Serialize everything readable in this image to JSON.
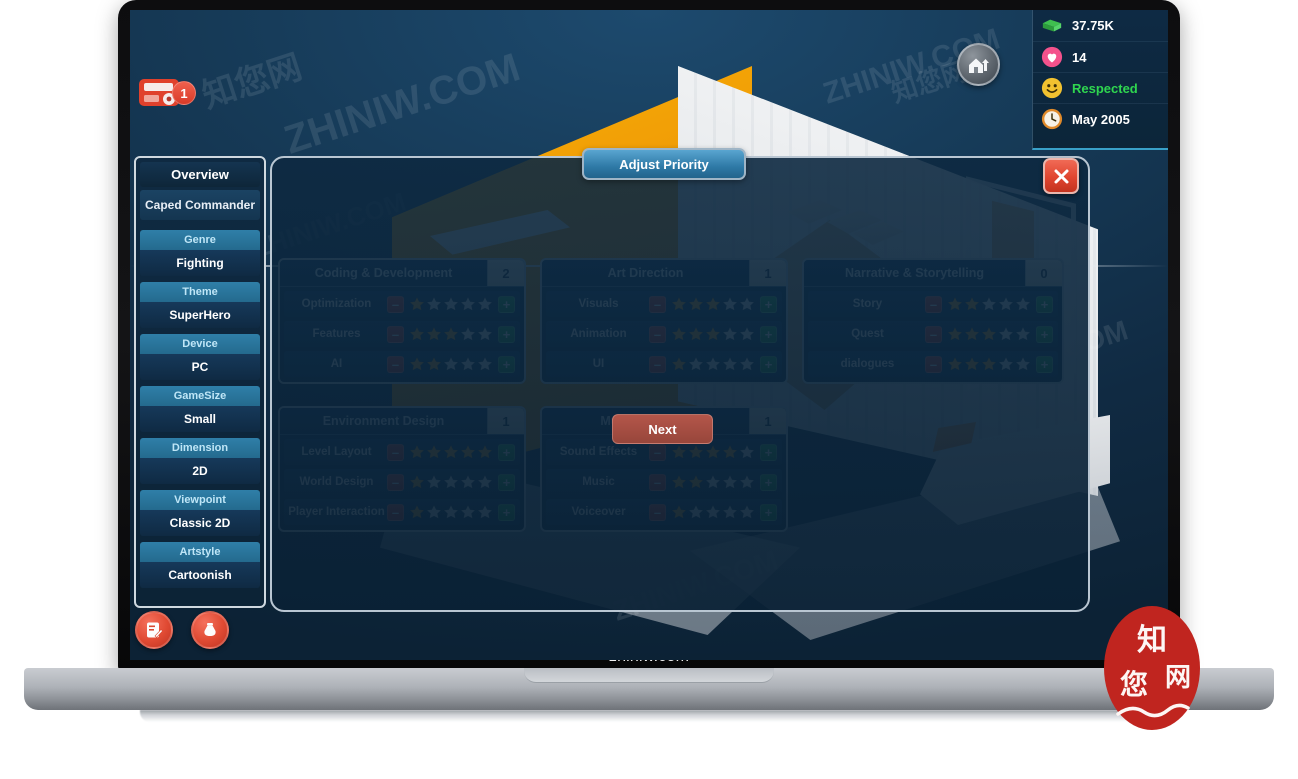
{
  "site_watermark": "zhiniw.com",
  "hud": {
    "money": {
      "icon": "money-icon",
      "value": "37.75K"
    },
    "hearts": {
      "icon": "heart-icon",
      "value": "14"
    },
    "reputation": {
      "icon": "smiley-icon",
      "value": "Respected",
      "color": "#2fd64f"
    },
    "date": {
      "icon": "clock-icon",
      "value": "May 2005"
    }
  },
  "topbar": {
    "home_button": "home-upgrade-button",
    "mail_button": "mail-button",
    "mail_badge": "1"
  },
  "corner_buttons": [
    {
      "name": "notes-button",
      "icon": "notepad-icon"
    },
    {
      "name": "finance-button",
      "icon": "money-bag-icon"
    }
  ],
  "sidebar": {
    "title": "Overview",
    "project_name": "Caped Commander",
    "groups": [
      {
        "head": "Genre",
        "value": "Fighting"
      },
      {
        "head": "Theme",
        "value": "SuperHero"
      },
      {
        "head": "Device",
        "value": "PC"
      },
      {
        "head": "GameSize",
        "value": "Small"
      },
      {
        "head": "Dimension",
        "value": "2D"
      },
      {
        "head": "Viewpoint",
        "value": "Classic 2D"
      },
      {
        "head": "Artstyle",
        "value": "Cartoonish"
      }
    ]
  },
  "modal": {
    "header_button": "Adjust Priority",
    "close_label": "✕",
    "next_button": "Next",
    "max_stars": 5,
    "panels": [
      {
        "title": "Coding & Development",
        "count": "2",
        "rows": [
          {
            "label": "Optimization",
            "stars": 1
          },
          {
            "label": "Features",
            "stars": 3
          },
          {
            "label": "AI",
            "stars": 2
          }
        ]
      },
      {
        "title": "Art Direction",
        "count": "1",
        "rows": [
          {
            "label": "Visuals",
            "stars": 3
          },
          {
            "label": "Animation",
            "stars": 3
          },
          {
            "label": "UI",
            "stars": 1
          }
        ]
      },
      {
        "title": "Narrative & Storytelling",
        "count": "0",
        "rows": [
          {
            "label": "Story",
            "stars": 2
          },
          {
            "label": "Quest",
            "stars": 3
          },
          {
            "label": "dialogues",
            "stars": 3
          }
        ]
      },
      {
        "title": "Environment Design",
        "count": "1",
        "rows": [
          {
            "label": "Level Layout",
            "stars": 5
          },
          {
            "label": "World Design",
            "stars": 1
          },
          {
            "label": "Player Interaction",
            "stars": 1
          }
        ]
      },
      {
        "title": "Music & Sound",
        "count": "1",
        "rows": [
          {
            "label": "Sound Effects",
            "stars": 4
          },
          {
            "label": "Music",
            "stars": 2
          },
          {
            "label": "Voiceover",
            "stars": 1
          }
        ]
      }
    ],
    "decrease_label": "–",
    "increase_label": "+"
  },
  "colors": {
    "star_filled": "#f5a623",
    "star_empty": "#f1f3f5",
    "minus": "#d93b28",
    "plus": "#23a24d",
    "accent_blue": "#2e79a6",
    "panel_bg": "#0f3457"
  },
  "watermarks": [
    "ZHINIW.COM",
    "知您网"
  ]
}
